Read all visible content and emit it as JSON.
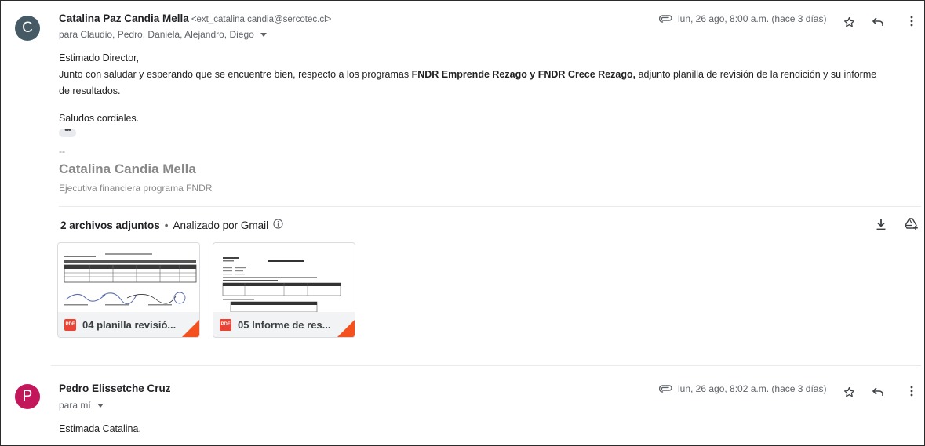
{
  "message1": {
    "avatar_letter": "C",
    "avatar_color": "#455a64",
    "sender_name": "Catalina Paz Candia Mella",
    "sender_email": "<ext_catalina.candia@sercotec.cl>",
    "recipients": "para Claudio, Pedro, Daniela, Alejandro, Diego",
    "date": "lun, 26 ago, 8:00 a.m. (hace 3 días)",
    "body": {
      "greeting": "Estimado Director,",
      "line1_pre": "Junto con saludar y esperando que se encuentre bien, respecto a los programas ",
      "line1_bold": "FNDR Emprende Rezago y FNDR Crece Rezago,",
      "line1_post": " adjunto planilla de revisión de la rendición y su informe",
      "line2": "de resultados.",
      "closing": "Saludos cordiales.",
      "dots": "•••",
      "sig_dash": "--",
      "sig_name": "Catalina Candia Mella",
      "sig_title": "Ejecutiva financiera programa FNDR"
    },
    "attachments": {
      "count_label": "2 archivos adjuntos",
      "separator": "•",
      "scanned_label": "Analizado por Gmail",
      "files": [
        {
          "name": "04 planilla revisió...",
          "type": "PDF"
        },
        {
          "name": "05 Informe de res...",
          "type": "PDF"
        }
      ]
    }
  },
  "message2": {
    "avatar_letter": "P",
    "avatar_color": "#c2185b",
    "sender_name": "Pedro Elissetche Cruz",
    "recipients": "para mí",
    "date": "lun, 26 ago, 8:02 a.m. (hace 3 días)",
    "body_start": "Estimada Catalina,"
  },
  "icons": {
    "attachment": "paperclip-icon",
    "star": "star-icon",
    "reply": "reply-icon",
    "more": "more-vert-icon",
    "download": "download-icon",
    "drive": "add-to-drive-icon",
    "info": "info-icon"
  }
}
